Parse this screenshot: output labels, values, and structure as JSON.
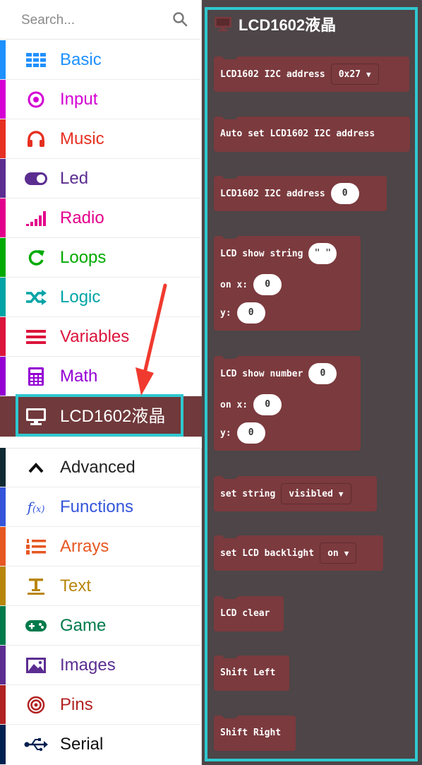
{
  "search": {
    "placeholder": "Search..."
  },
  "categories": [
    {
      "label": "Basic",
      "color": "#1e90ff",
      "icon": "grid-icon"
    },
    {
      "label": "Input",
      "color": "#d400d4",
      "icon": "target-icon"
    },
    {
      "label": "Music",
      "color": "#e63022",
      "icon": "headphones-icon"
    },
    {
      "label": "Led",
      "color": "#5c2d91",
      "icon": "toggle-icon"
    },
    {
      "label": "Radio",
      "color": "#e3008c",
      "icon": "signal-bars-icon"
    },
    {
      "label": "Loops",
      "color": "#00aa00",
      "icon": "refresh-icon"
    },
    {
      "label": "Logic",
      "color": "#00a4a6",
      "icon": "shuffle-icon"
    },
    {
      "label": "Variables",
      "color": "#dc143c",
      "icon": "lines-icon"
    },
    {
      "label": "Math",
      "color": "#9400d3",
      "icon": "calculator-icon"
    },
    {
      "label": "LCD1602液晶",
      "color": "#70393b",
      "icon": "monitor-icon"
    },
    {
      "label": "Advanced",
      "color": "#0f2a33",
      "icon": "chevron-up-icon"
    },
    {
      "label": "Functions",
      "color": "#3455db",
      "icon": "function-icon"
    },
    {
      "label": "Arrays",
      "color": "#e65722",
      "icon": "ordered-list-icon"
    },
    {
      "label": "Text",
      "color": "#b8860b",
      "icon": "text-icon"
    },
    {
      "label": "Game",
      "color": "#007a4b",
      "icon": "gamepad-icon"
    },
    {
      "label": "Images",
      "color": "#5c2d91",
      "icon": "image-icon"
    },
    {
      "label": "Pins",
      "color": "#b22222",
      "icon": "pins-icon"
    },
    {
      "label": "Serial",
      "color": "#002050",
      "icon": "usb-icon"
    }
  ],
  "flyout": {
    "title": "LCD1602液晶",
    "background": "#4d4547",
    "block_color": "#7b3a3e",
    "highlight_color": "#2fc8cf",
    "blocks": {
      "i2c_address_dd": {
        "text": "LCD1602 I2C address",
        "value": "0x27"
      },
      "auto_set": {
        "text": "Auto set LCD1602 I2C address"
      },
      "i2c_address_num": {
        "text": "LCD1602 I2C address",
        "value": "0"
      },
      "show_string": {
        "text": "LCD show string",
        "value": "\" \"",
        "x_label": "on x:",
        "x_value": "0",
        "y_label": "y:",
        "y_value": "0"
      },
      "show_number": {
        "text": "LCD show number",
        "value": "0",
        "x_label": "on x:",
        "x_value": "0",
        "y_label": "y:",
        "y_value": "0"
      },
      "set_string": {
        "text": "set string",
        "value": "visibled"
      },
      "backlight": {
        "text": "set LCD backlight",
        "value": "on"
      },
      "clear": {
        "text": "LCD clear"
      },
      "shift_left": {
        "text": "Shift Left"
      },
      "shift_right": {
        "text": "Shift Right"
      }
    }
  }
}
